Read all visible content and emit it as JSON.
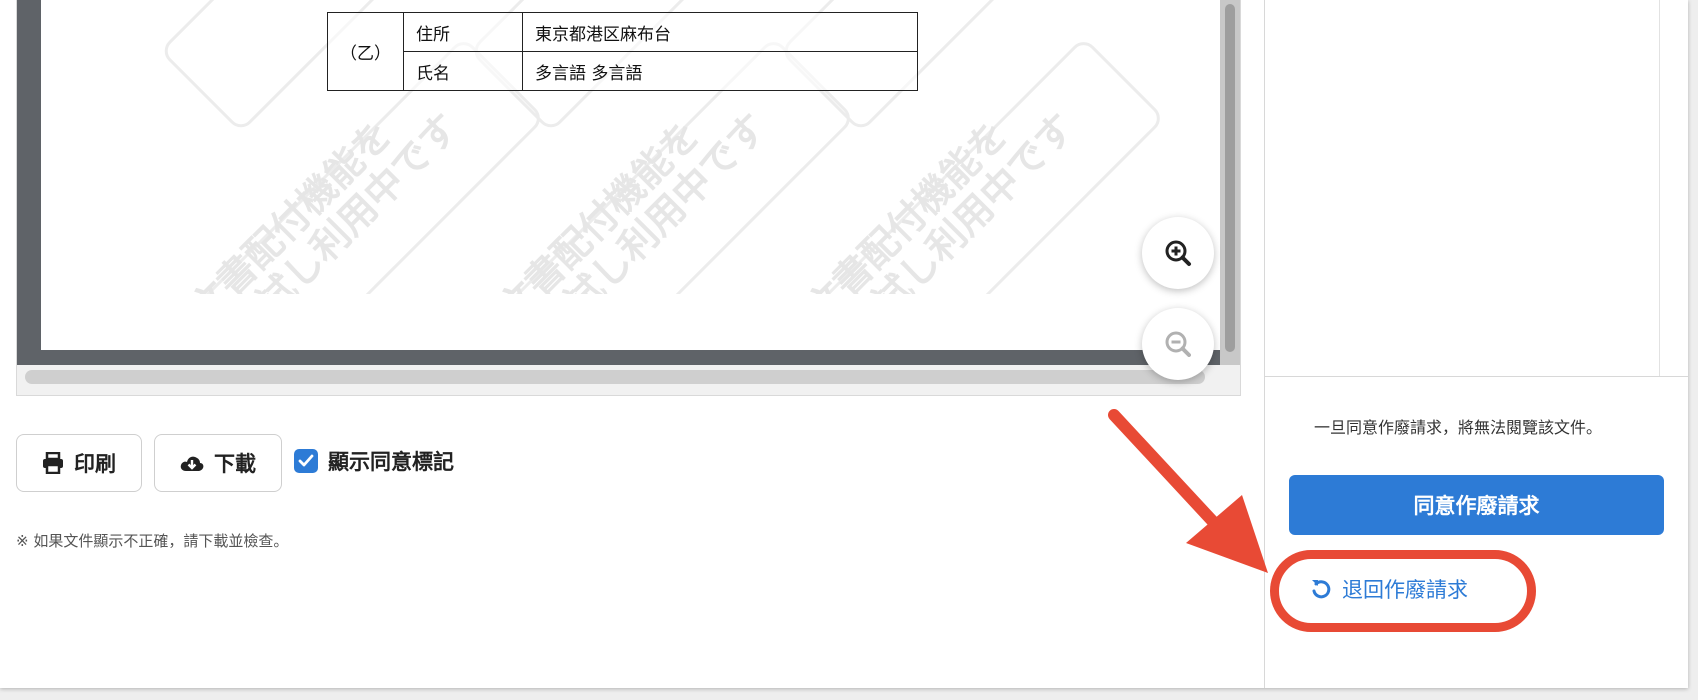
{
  "document": {
    "party_label": "（乙）",
    "rows": [
      {
        "label": "住所",
        "value": "東京都港区麻布台"
      },
      {
        "label": "氏名",
        "value": "多言語  多言語"
      }
    ],
    "watermark_line1": "文書配付機能を",
    "watermark_line2": "お試し利用中です"
  },
  "toolbar": {
    "print_label": "印刷",
    "download_label": "下載",
    "show_marks_label": "顯示同意標記",
    "show_marks_checked": true
  },
  "note": "※ 如果文件顯示不正確，請下載並檢查。",
  "side_panel": {
    "warning": "一旦同意作廢請求，將無法閱覽該文件。",
    "agree_button": "同意作廢請求",
    "withdraw_button": "退回作廢請求"
  },
  "colors": {
    "primary": "#2d7bd6",
    "annotation": "#e84a35"
  },
  "icons": [
    "printer-icon",
    "cloud-download-icon",
    "check-icon",
    "zoom-in-icon",
    "zoom-out-icon",
    "undo-icon"
  ]
}
